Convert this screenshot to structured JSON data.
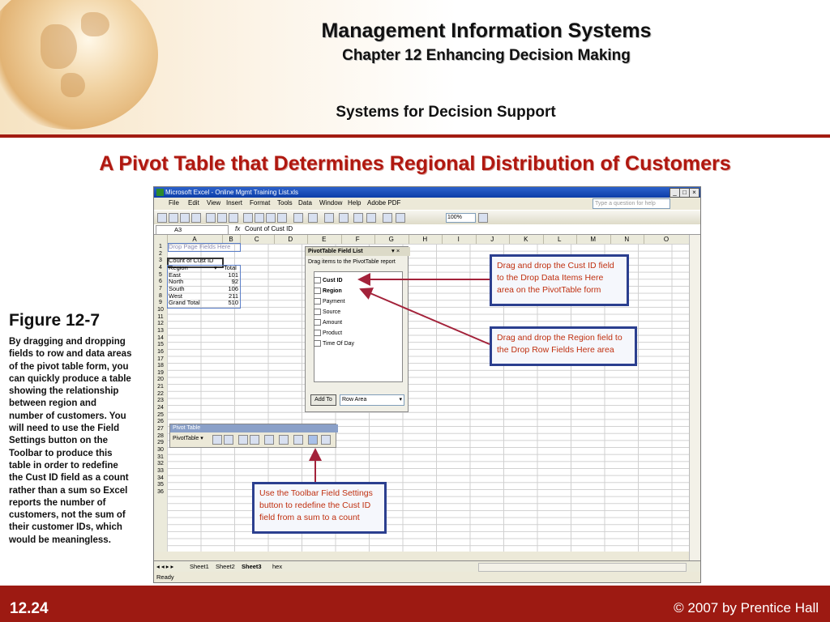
{
  "header": {
    "title": "Management Information Systems",
    "chapter": "Chapter 12 Enhancing Decision Making",
    "section": "Systems for Decision Support"
  },
  "slide_title": "A Pivot Table that Determines Regional Distribution of Customers",
  "figure": {
    "heading": "Figure 12-7",
    "caption": "By dragging and dropping fields to row and data areas of the pivot table form, you can quickly produce a table showing the relationship between region and number of customers. You will need to use the Field Settings button on the Toolbar to produce this table in order to redefine the Cust ID field as a count rather than a sum so Excel reports the number of customers, not the sum of their customer IDs, which would be meaningless."
  },
  "footer": {
    "slide_number": "12.24",
    "copyright": "© 2007 by Prentice Hall"
  },
  "excel": {
    "window_title": "Microsoft Excel - Online Mgmt Training List.xls",
    "menu": [
      "File",
      "Edit",
      "View",
      "Insert",
      "Format",
      "Tools",
      "Data",
      "Window",
      "Help",
      "Adobe PDF"
    ],
    "help_placeholder": "Type a question for help",
    "zoom": "100%",
    "name_box": "A3",
    "formula_label": "fx",
    "formula": "Count of Cust ID",
    "columns": [
      "A",
      "B",
      "C",
      "D",
      "E",
      "F",
      "G",
      "H",
      "I",
      "J",
      "K",
      "L",
      "M",
      "N",
      "O"
    ],
    "rows": [
      "1",
      "2",
      "3",
      "4",
      "5",
      "6",
      "7",
      "8",
      "9",
      "10",
      "11",
      "12",
      "13",
      "14",
      "15",
      "16",
      "17",
      "18",
      "19",
      "20",
      "21",
      "22",
      "23",
      "24",
      "25",
      "26",
      "27",
      "28",
      "29",
      "30",
      "31",
      "32",
      "33",
      "34",
      "35",
      "36"
    ],
    "pivot": {
      "drop_page": "Drop Page Fields Here",
      "data_label": "Count of Cust ID",
      "row_header": "Region",
      "total_header": "Total",
      "regions": [
        {
          "name": "East",
          "value": "101"
        },
        {
          "name": "North",
          "value": "92"
        },
        {
          "name": "South",
          "value": "106"
        },
        {
          "name": "West",
          "value": "211"
        }
      ],
      "grand_total_label": "Grand Total",
      "grand_total": "510"
    },
    "field_list": {
      "title": "PivotTable Field List",
      "instruction": "Drag items to the PivotTable report",
      "fields": [
        "Cust ID",
        "Region",
        "Payment",
        "Source",
        "Amount",
        "Product",
        "Time Of Day"
      ],
      "add_button": "Add To",
      "area_select": "Row Area"
    },
    "pivot_toolbar": {
      "title": "Pivot Table",
      "menu": "PivotTable ▾"
    },
    "sheet_tabs": [
      "Sheet1",
      "Sheet2",
      "Sheet3",
      "hex"
    ],
    "active_sheet": "Sheet3",
    "status": "Ready"
  },
  "callouts": {
    "cust_id": "Drag and drop the Cust ID field to the Drop Data Items Here area on the PivotTable form",
    "region": "Drag and drop the Region field to the Drop Row Fields Here area",
    "toolbar": "Use the Toolbar Field Settings button to redefine the Cust ID field from a sum to a count"
  },
  "colors": {
    "accent_red": "#9d1a12",
    "title_red": "#b01810",
    "callout_border": "#2b3f8f",
    "callout_text": "#c03010",
    "arrow": "#a3223a"
  }
}
